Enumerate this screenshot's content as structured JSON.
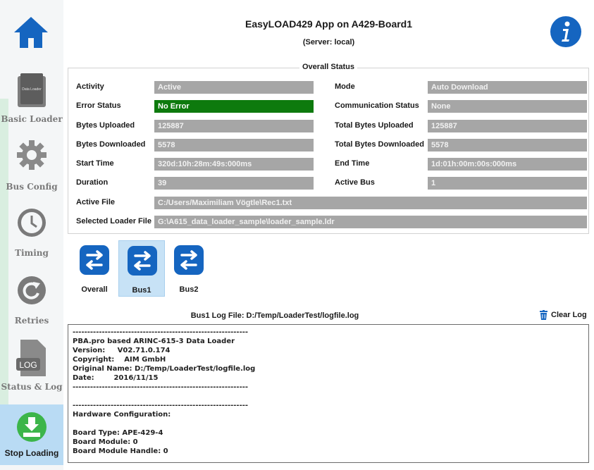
{
  "header": {
    "title": "EasyLOAD429 App on A429-Board1",
    "subtitle": "(Server: local)"
  },
  "sidebar": {
    "items": [
      {
        "label": "Basic Loader",
        "icon": "folder-icon",
        "icon_text": "Data Loader"
      },
      {
        "label": "Bus Config",
        "icon": "gear-icon"
      },
      {
        "label": "Timing",
        "icon": "clock-icon"
      },
      {
        "label": "Retries",
        "icon": "retry-icon"
      },
      {
        "label": "Status & Log",
        "icon": "log-file-icon",
        "icon_text": "LOG"
      },
      {
        "label": "Stop Loading",
        "icon": "download-stop-icon"
      }
    ]
  },
  "status": {
    "group_title": "Overall Status",
    "activity": {
      "label": "Activity",
      "value": "Active"
    },
    "mode": {
      "label": "Mode",
      "value": "Auto Download"
    },
    "error_status": {
      "label": "Error Status",
      "value": "No Error"
    },
    "communication_status": {
      "label": "Communication Status",
      "value": "None"
    },
    "bytes_uploaded": {
      "label": "Bytes Uploaded",
      "value": "125887"
    },
    "total_bytes_uploaded": {
      "label": "Total Bytes Uploaded",
      "value": "125887"
    },
    "bytes_downloaded": {
      "label": "Bytes Downloaded",
      "value": "5578"
    },
    "total_bytes_downloaded": {
      "label": "Total Bytes Downloaded",
      "value": "5578"
    },
    "start_time": {
      "label": "Start Time",
      "value": "320d:10h:28m:49s:000ms"
    },
    "end_time": {
      "label": "End Time",
      "value": "1d:01h:00m:00s:000ms"
    },
    "duration": {
      "label": "Duration",
      "value": "39"
    },
    "active_bus": {
      "label": "Active Bus",
      "value": "1"
    },
    "active_file": {
      "label": "Active File",
      "value": "C:/Users/Maximiliam Vögtle\\Rec1.txt"
    },
    "selected_loader_file": {
      "label": "Selected Loader File",
      "value": "G:\\A615_data_loader_sample\\loader_sample.ldr"
    }
  },
  "bus_buttons": [
    {
      "label": "Overall",
      "selected": false
    },
    {
      "label": "Bus1",
      "selected": true
    },
    {
      "label": "Bus2",
      "selected": false
    }
  ],
  "log": {
    "title": "Bus1 Log File: D:/Temp/LoaderTest/logfile.log",
    "clear_label": "Clear Log",
    "lines": [
      "------------------------------------------------------------",
      "PBA.pro based ARINC-615-3 Data Loader",
      "Version:     V02.71.0.174",
      "Copyright:    AIM GmbH",
      "Original Name: D:/Temp/LoaderTest/logfile.log",
      "Date:        2016/11/15",
      "------------------------------------------------------------",
      "",
      "------------------------------------------------------------",
      "Hardware Configuration:",
      "",
      "Board Type: APE-429-4",
      "Board Module: 0",
      "Board Module Handle: 0"
    ]
  },
  "colors": {
    "accent_blue": "#1565c0",
    "field_gray": "#a6a6a6",
    "ok_green": "#0d7a0d",
    "selected_bg": "#c7e2f6",
    "stop_green": "#3cb54a"
  }
}
